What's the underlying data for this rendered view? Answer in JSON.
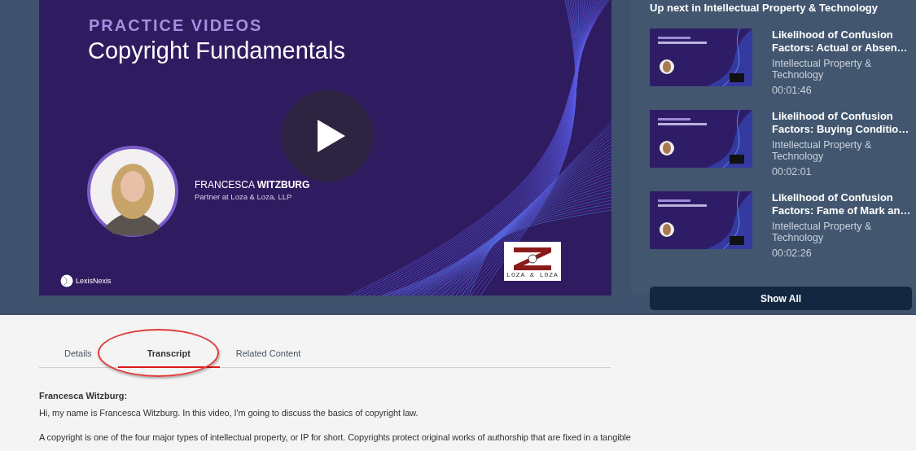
{
  "video": {
    "kicker": "PRACTICE VIDEOS",
    "title": "Copyright Fundamentals",
    "presenter_first": "FRANCESCA",
    "presenter_last": "WITZBURG",
    "presenter_role": "Partner at Loza & Loza, LLP",
    "brand": "LexisNexis",
    "logo_text": "LOZA & LOZA"
  },
  "up_next": {
    "heading": "Up next in Intellectual Property & Technology",
    "items": [
      {
        "title": "Likelihood of Confusion Factors: Actual or Absen…",
        "category": "Intellectual Property & Technology",
        "duration": "00:01:46"
      },
      {
        "title": "Likelihood of Confusion Factors: Buying Conditio…",
        "category": "Intellectual Property & Technology",
        "duration": "00:02:01"
      },
      {
        "title": "Likelihood of Confusion Factors: Fame of Mark an…",
        "category": "Intellectual Property & Technology",
        "duration": "00:02:26"
      }
    ],
    "show_all": "Show All"
  },
  "tabs": [
    {
      "label": "Details",
      "selected": false
    },
    {
      "label": "Transcript",
      "selected": true
    },
    {
      "label": "Related Content",
      "selected": false
    }
  ],
  "transcript": {
    "speaker": "Francesca Witzburg:",
    "paragraphs": [
      "Hi, my name is Francesca Witzburg. In this video, I'm going to discuss the basics of copyright law.",
      "A copyright is one of the four major types of intellectual property, or IP for short. Copyrights protect original works of authorship that are fixed in a tangible"
    ]
  }
}
